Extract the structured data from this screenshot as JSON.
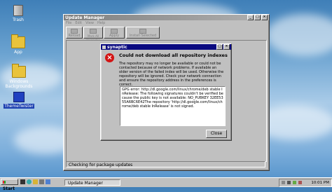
{
  "desktop": {
    "icons": [
      {
        "label": "Trash",
        "icon": "trash-icon"
      },
      {
        "label": "App",
        "icon": "folder-icon"
      },
      {
        "label": "Windows Backgrounds",
        "icon": "folder-icon"
      },
      {
        "label": "ThemeTwister",
        "icon": "theme-twister-icon"
      }
    ]
  },
  "update_manager": {
    "title": "Update Manager",
    "menu": [
      "File",
      "Edit",
      "View",
      "Help"
    ],
    "toolbar": [
      "Reload",
      "Mark All Upgrades",
      "Apply",
      "Install Selected"
    ],
    "status": "Checking for package updates"
  },
  "dialog": {
    "title": "synaptic",
    "heading": "Could not download all repository indexes",
    "message": "The repository may no longer be available or could not be contacted because of network problems. If available an older version of the failed index will be used. Otherwise the repository will be ignored. Check your network connection and ensure the repository address in the preferences is correct.",
    "details": "GPG error: http://dl.google.com/linux/chrome/deb stable InRelease: The following signatures couldn't be verified because the public key is not available: NO_PUBKEY 32EE5355A6BC6E42The repository 'http://dl.google.com/linux/chrome/deb stable InRelease' is not signed.",
    "close_label": "Close",
    "colors": {
      "title_bar": "#0a0a80",
      "error": "#d31414"
    }
  },
  "taskbar": {
    "start_label": "Start",
    "window_label": "Update Manager",
    "clock": "10:01 PM"
  }
}
